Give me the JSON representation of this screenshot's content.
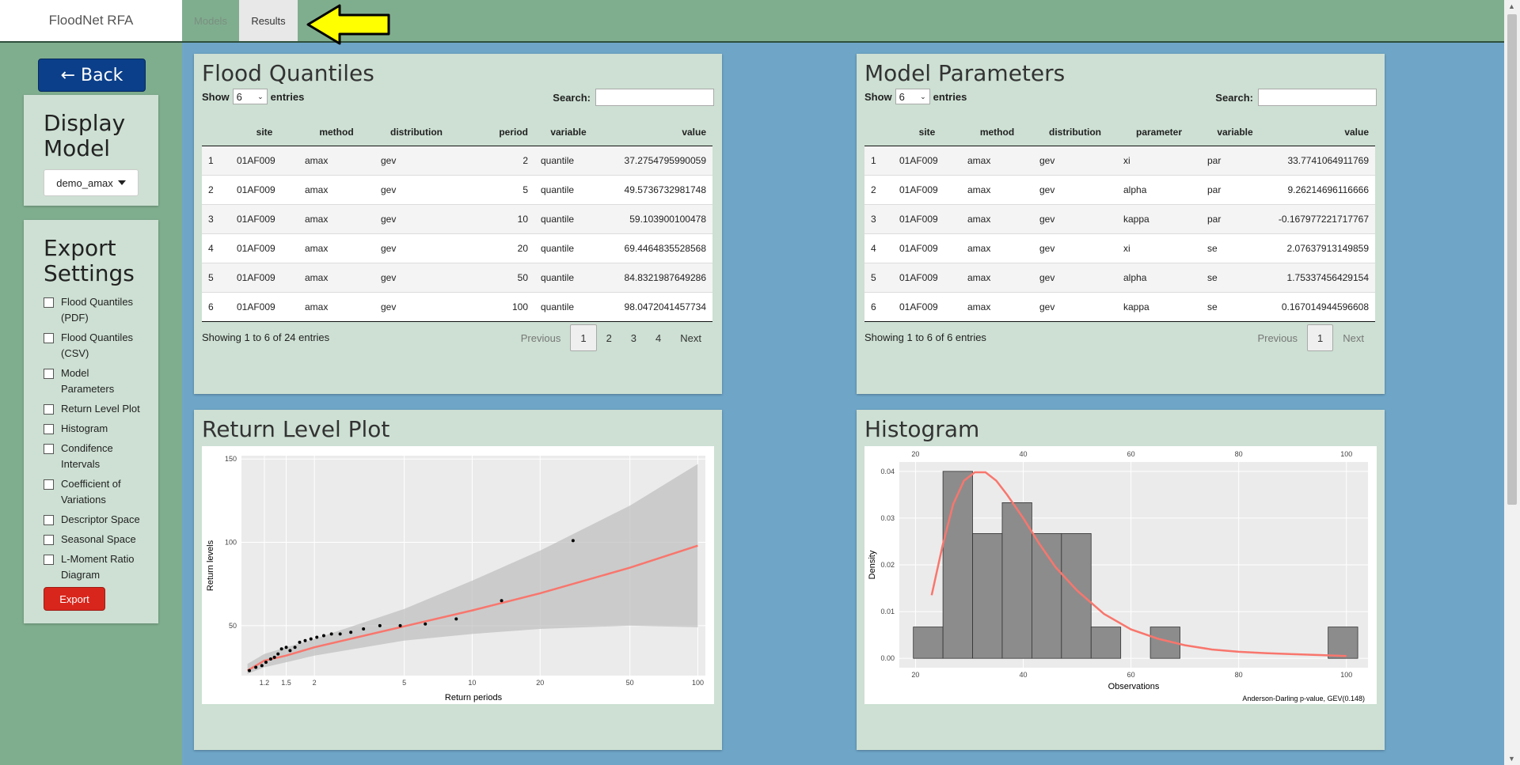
{
  "nav": {
    "brand": "FloodNet RFA",
    "tabs": [
      {
        "label": "Models"
      },
      {
        "label": "Results"
      }
    ]
  },
  "sidebar": {
    "back_label": "← Back",
    "display_model": {
      "title": "Display Model",
      "selected": "demo_amax"
    },
    "export": {
      "title": "Export Settings",
      "options": [
        {
          "label": "Flood Quantiles (PDF)",
          "checked": false
        },
        {
          "label": "Flood Quantiles (CSV)",
          "checked": false
        },
        {
          "label": "Model Parameters",
          "checked": false
        },
        {
          "label": "Return Level Plot",
          "checked": false
        },
        {
          "label": "Histogram",
          "checked": false
        },
        {
          "label": "Condifence Intervals",
          "checked": false
        },
        {
          "label": "Coefficient of Variations",
          "checked": false
        },
        {
          "label": "Descriptor Space",
          "checked": false
        },
        {
          "label": "Seasonal Space",
          "checked": false
        },
        {
          "label": "L-Moment Ratio Diagram",
          "checked": false
        }
      ],
      "button_label": "Export"
    }
  },
  "quantiles": {
    "title": "Flood Quantiles",
    "show_label": "Show",
    "entries_label": "entries",
    "page_length": "6",
    "search_label": "Search:",
    "columns": [
      "",
      "site",
      "method",
      "distribution",
      "period",
      "variable",
      "value"
    ],
    "rows": [
      [
        "1",
        "01AF009",
        "amax",
        "gev",
        "2",
        "quantile",
        "37.2754795990059"
      ],
      [
        "2",
        "01AF009",
        "amax",
        "gev",
        "5",
        "quantile",
        "49.5736732981748"
      ],
      [
        "3",
        "01AF009",
        "amax",
        "gev",
        "10",
        "quantile",
        "59.103900100478"
      ],
      [
        "4",
        "01AF009",
        "amax",
        "gev",
        "20",
        "quantile",
        "69.4464835528568"
      ],
      [
        "5",
        "01AF009",
        "amax",
        "gev",
        "50",
        "quantile",
        "84.8321987649286"
      ],
      [
        "6",
        "01AF009",
        "amax",
        "gev",
        "100",
        "quantile",
        "98.0472041457734"
      ]
    ],
    "info": "Showing 1 to 6 of 24 entries",
    "pager": {
      "prev": "Previous",
      "pages": [
        "1",
        "2",
        "3",
        "4"
      ],
      "next": "Next",
      "current": "1"
    }
  },
  "parameters": {
    "title": "Model Parameters",
    "show_label": "Show",
    "entries_label": "entries",
    "page_length": "6",
    "search_label": "Search:",
    "columns": [
      "",
      "site",
      "method",
      "distribution",
      "parameter",
      "variable",
      "value"
    ],
    "rows": [
      [
        "1",
        "01AF009",
        "amax",
        "gev",
        "xi",
        "par",
        "33.7741064911769"
      ],
      [
        "2",
        "01AF009",
        "amax",
        "gev",
        "alpha",
        "par",
        "9.26214696116666"
      ],
      [
        "3",
        "01AF009",
        "amax",
        "gev",
        "kappa",
        "par",
        "-0.167977221717767"
      ],
      [
        "4",
        "01AF009",
        "amax",
        "gev",
        "xi",
        "se",
        "2.07637913149859"
      ],
      [
        "5",
        "01AF009",
        "amax",
        "gev",
        "alpha",
        "se",
        "1.75337456429154"
      ],
      [
        "6",
        "01AF009",
        "amax",
        "gev",
        "kappa",
        "se",
        "0.167014944596608"
      ]
    ],
    "info": "Showing 1 to 6 of 6 entries",
    "pager": {
      "prev": "Previous",
      "pages": [
        "1"
      ],
      "next": "Next",
      "current": "1"
    }
  },
  "chart_data": [
    {
      "type": "scatter",
      "panel_title": "Return Level Plot",
      "xlabel": "Return periods",
      "ylabel": "Return levels",
      "x_scale": "log",
      "x_ticks": [
        1.2,
        1.5,
        2,
        5,
        10,
        20,
        50,
        100
      ],
      "y_ticks": [
        50,
        100,
        150
      ],
      "ylim": [
        20,
        152
      ],
      "grid": true,
      "points": {
        "x": [
          1.03,
          1.1,
          1.17,
          1.22,
          1.28,
          1.33,
          1.38,
          1.43,
          1.5,
          1.56,
          1.64,
          1.72,
          1.82,
          1.93,
          2.05,
          2.2,
          2.38,
          2.6,
          2.9,
          3.3,
          3.9,
          4.8,
          6.2,
          8.5,
          13.5,
          28
        ],
        "y": [
          23,
          25,
          26,
          28,
          30,
          31,
          33,
          36,
          37,
          35,
          37,
          40,
          41,
          42,
          43,
          44,
          45,
          45,
          46,
          48,
          50,
          50,
          51,
          54,
          65,
          101
        ]
      },
      "series": [
        {
          "name": "fit",
          "color": "#f8766d",
          "x": [
            1.01,
            1.2,
            1.5,
            2,
            5,
            10,
            20,
            50,
            100
          ],
          "y": [
            23,
            29,
            32,
            37,
            49.6,
            59.1,
            69.4,
            84.8,
            98
          ]
        }
      ],
      "band": {
        "x": [
          1.01,
          1.2,
          1.5,
          2,
          5,
          10,
          20,
          50,
          100
        ],
        "lower": [
          21,
          25,
          28,
          32,
          41,
          45,
          48,
          50,
          49
        ],
        "upper": [
          27,
          33,
          37,
          42,
          60,
          77,
          95,
          122,
          147
        ]
      }
    },
    {
      "type": "bar",
      "panel_title": "Histogram",
      "xlabel": "Observations",
      "ylabel": "Density",
      "x_ticks": [
        20,
        40,
        60,
        80,
        100
      ],
      "y_ticks": [
        0.0,
        0.01,
        0.02,
        0.03,
        0.04
      ],
      "xlim": [
        17,
        104
      ],
      "ylim": [
        -0.002,
        0.042
      ],
      "grid": true,
      "bin_edges": [
        19.6,
        25.1,
        30.6,
        36.1,
        41.6,
        47.1,
        52.6,
        58.1,
        63.6,
        69.1,
        74.6,
        80.1,
        85.6,
        91.1,
        96.6,
        102.1
      ],
      "values": [
        0.0067,
        0.04,
        0.0267,
        0.0333,
        0.0267,
        0.0267,
        0.0067,
        0,
        0.0067,
        0,
        0,
        0,
        0,
        0,
        0.0067
      ],
      "series": [
        {
          "name": "GEV density",
          "color": "#f8766d",
          "x": [
            23,
            25,
            27,
            29,
            31,
            33,
            35,
            37,
            40,
            43,
            46,
            50,
            55,
            60,
            65,
            70,
            75,
            80,
            85,
            90,
            95,
            100
          ],
          "y": [
            0.0135,
            0.024,
            0.033,
            0.038,
            0.0398,
            0.0398,
            0.038,
            0.035,
            0.03,
            0.0245,
            0.0195,
            0.0145,
            0.0095,
            0.0062,
            0.0042,
            0.0028,
            0.0019,
            0.0014,
            0.0011,
            0.0009,
            0.0007,
            0.0005
          ]
        }
      ],
      "caption": "Anderson-Darling p-value, GEV(0.148)"
    }
  ]
}
